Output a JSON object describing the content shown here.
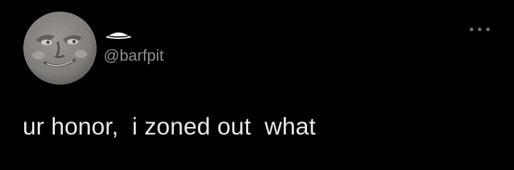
{
  "tweet": {
    "handle": "@barfpit",
    "text": "ur honor,  i zoned out  what",
    "display_name_icon": "eyeless-emoji-icon",
    "more_icon": "more-horizontal-icon",
    "avatar_icon": "moon-face-avatar"
  },
  "colors": {
    "background": "#000000",
    "text_primary": "#e7e9ea",
    "text_secondary": "#8b8f94"
  }
}
